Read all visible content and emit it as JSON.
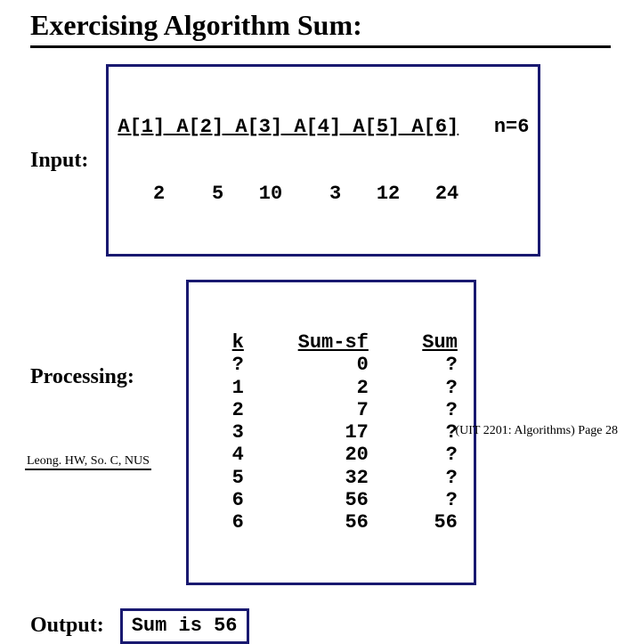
{
  "title": "Exercising Algorithm Sum:",
  "labels": {
    "input": "Input:",
    "processing": "Processing:",
    "output": "Output:"
  },
  "input": {
    "headers": [
      "A[1]",
      "A[2]",
      "A[3]",
      "A[4]",
      "A[5]",
      "A[6]"
    ],
    "values": [
      2,
      5,
      10,
      3,
      12,
      24
    ],
    "n_label": "n=6"
  },
  "processing": {
    "columns": [
      "k",
      "Sum-sf",
      "Sum"
    ],
    "rows": [
      {
        "k": "?",
        "sumsf": 0,
        "sum": "?"
      },
      {
        "k": 1,
        "sumsf": 2,
        "sum": "?"
      },
      {
        "k": 2,
        "sumsf": 7,
        "sum": "?"
      },
      {
        "k": 3,
        "sumsf": 17,
        "sum": "?"
      },
      {
        "k": 4,
        "sumsf": 20,
        "sum": "?"
      },
      {
        "k": 5,
        "sumsf": 32,
        "sum": "?"
      },
      {
        "k": 6,
        "sumsf": 56,
        "sum": "?"
      },
      {
        "k": 6,
        "sumsf": 56,
        "sum": 56
      }
    ]
  },
  "output": {
    "text": "Sum is 56"
  },
  "footer": {
    "right": "(UIT 2201: Algorithms) Page 28",
    "left": "Leong. HW, So. C, NUS"
  }
}
